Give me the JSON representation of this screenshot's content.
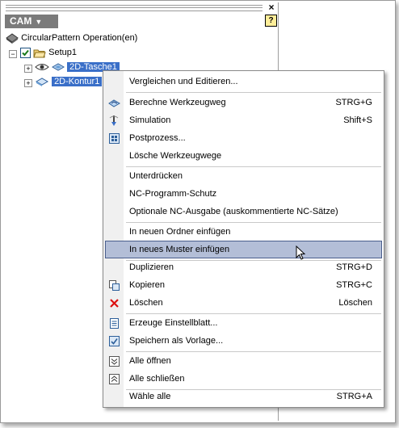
{
  "panel": {
    "title": "CAM",
    "close_glyph": "×",
    "help_glyph": "?"
  },
  "tree": {
    "root_label": "CircularPattern Operation(en)",
    "setup_label": "Setup1",
    "items": [
      {
        "label": "2D-Tasche1",
        "icon": "pocket-operation-icon"
      },
      {
        "label": "2D-Kontur1",
        "icon": "contour-operation-icon"
      }
    ]
  },
  "menu": {
    "items": [
      {
        "label": "Vergleichen und Editieren...",
        "shortcut": "",
        "icon": ""
      },
      {
        "label": "Berechne Werkzeugweg",
        "shortcut": "STRG+G",
        "icon": "generate-toolpath-icon"
      },
      {
        "label": "Simulation",
        "shortcut": "Shift+S",
        "icon": "simulation-icon"
      },
      {
        "label": "Postprozess...",
        "shortcut": "",
        "icon": "post-process-icon"
      },
      {
        "label": "Lösche Werkzeugwege",
        "shortcut": "",
        "icon": ""
      },
      {
        "label": "Unterdrücken",
        "shortcut": "",
        "icon": ""
      },
      {
        "label": "NC-Programm-Schutz",
        "shortcut": "",
        "icon": ""
      },
      {
        "label": "Optionale NC-Ausgabe (auskommentierte NC-Sätze)",
        "shortcut": "",
        "icon": ""
      },
      {
        "label": "In neuen Ordner einfügen",
        "shortcut": "",
        "icon": ""
      },
      {
        "label": "In neues Muster einfügen",
        "shortcut": "",
        "icon": ""
      },
      {
        "label": "Duplizieren",
        "shortcut": "STRG+D",
        "icon": ""
      },
      {
        "label": "Kopieren",
        "shortcut": "STRG+C",
        "icon": "copy-icon"
      },
      {
        "label": "Löschen",
        "shortcut": "Löschen",
        "icon": "delete-icon"
      },
      {
        "label": "Erzeuge Einstellblatt...",
        "shortcut": "",
        "icon": "setup-sheet-icon"
      },
      {
        "label": "Speichern als Vorlage...",
        "shortcut": "",
        "icon": "save-template-icon"
      },
      {
        "label": "Alle öffnen",
        "shortcut": "",
        "icon": "expand-all-icon"
      },
      {
        "label": "Alle schließen",
        "shortcut": "",
        "icon": "collapse-all-icon"
      },
      {
        "label": "Wähle alle",
        "shortcut": "STRG+A",
        "icon": ""
      }
    ],
    "highlighted_index": 9
  },
  "colors": {
    "selection": "#3a6fc8",
    "menu_highlight": "#b3bed7",
    "cam_header": "#7b7b7b"
  }
}
